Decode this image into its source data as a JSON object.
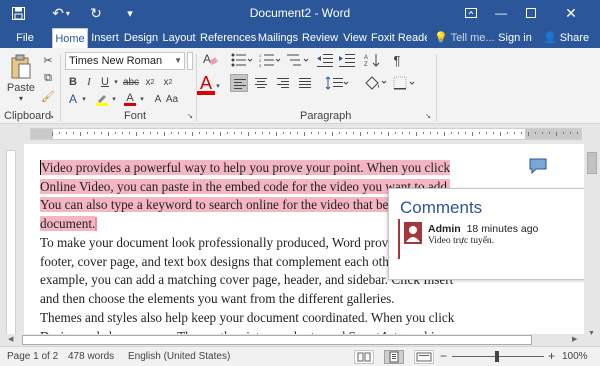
{
  "window": {
    "title": "Document2 - Word"
  },
  "tabs": [
    {
      "label": "File"
    },
    {
      "label": "Home"
    },
    {
      "label": "Insert"
    },
    {
      "label": "Design"
    },
    {
      "label": "Layout"
    },
    {
      "label": "References"
    },
    {
      "label": "Mailings"
    },
    {
      "label": "Review"
    },
    {
      "label": "View"
    },
    {
      "label": "Foxit Reader"
    }
  ],
  "active_tab": "Home",
  "tell_me": "Tell me...",
  "sign_in": "Sign in",
  "share": "Share",
  "ribbon": {
    "paste_label": "Paste",
    "font_name": "Times New Roman",
    "groups": {
      "clipboard": "Clipboard",
      "font": "Font",
      "paragraph": "Paragraph"
    }
  },
  "document": {
    "paragraphs": [
      {
        "lines": [
          "Video provides a powerful way to help you prove your point. When you click",
          "Online Video, you can paste in the embed code for the video you want to add.",
          "You can also type a keyword to search online for the video that best fits your",
          "document."
        ]
      },
      {
        "lines": [
          "To make your document look professionally produced, Word provides header,",
          "footer, cover page, and text box designs that complement each other. For",
          "example, you can add a matching cover page, header, and sidebar. Click Insert",
          "and then choose the elements you want from the different galleries."
        ]
      },
      {
        "lines": [
          "Themes and styles also help keep your document coordinated. When you click",
          "Design and choose a new Theme, the pictures, charts, and SmartArt graphics"
        ]
      }
    ]
  },
  "comments_pane": {
    "title": "Comments",
    "comment": {
      "author": "Admin",
      "time": "18 minutes ago",
      "text": "Video trực tuyến."
    }
  },
  "status": {
    "page": "Page 1 of 2",
    "words": "478 words",
    "language": "English (United States)",
    "zoom": "100%"
  },
  "colors": {
    "brand": "#2b579a",
    "highlight": "#f5b6c4",
    "comment_accent": "#a4373a"
  }
}
